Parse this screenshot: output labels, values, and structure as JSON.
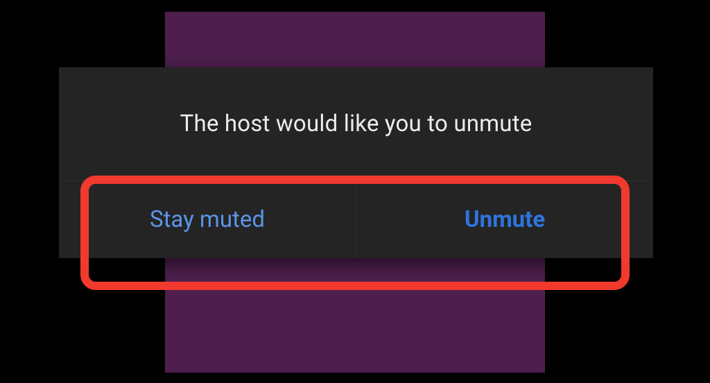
{
  "dialog": {
    "message": "The host would like you to unmute",
    "buttons": {
      "stay_muted": "Stay muted",
      "unmute": "Unmute"
    }
  },
  "colors": {
    "background": "#000000",
    "purple_panel": "#4e1f4e",
    "dialog_bg": "#242424",
    "text": "#ececec",
    "link_light": "#5a95e8",
    "link_bold": "#2e74dd",
    "highlight": "#f2392e"
  }
}
